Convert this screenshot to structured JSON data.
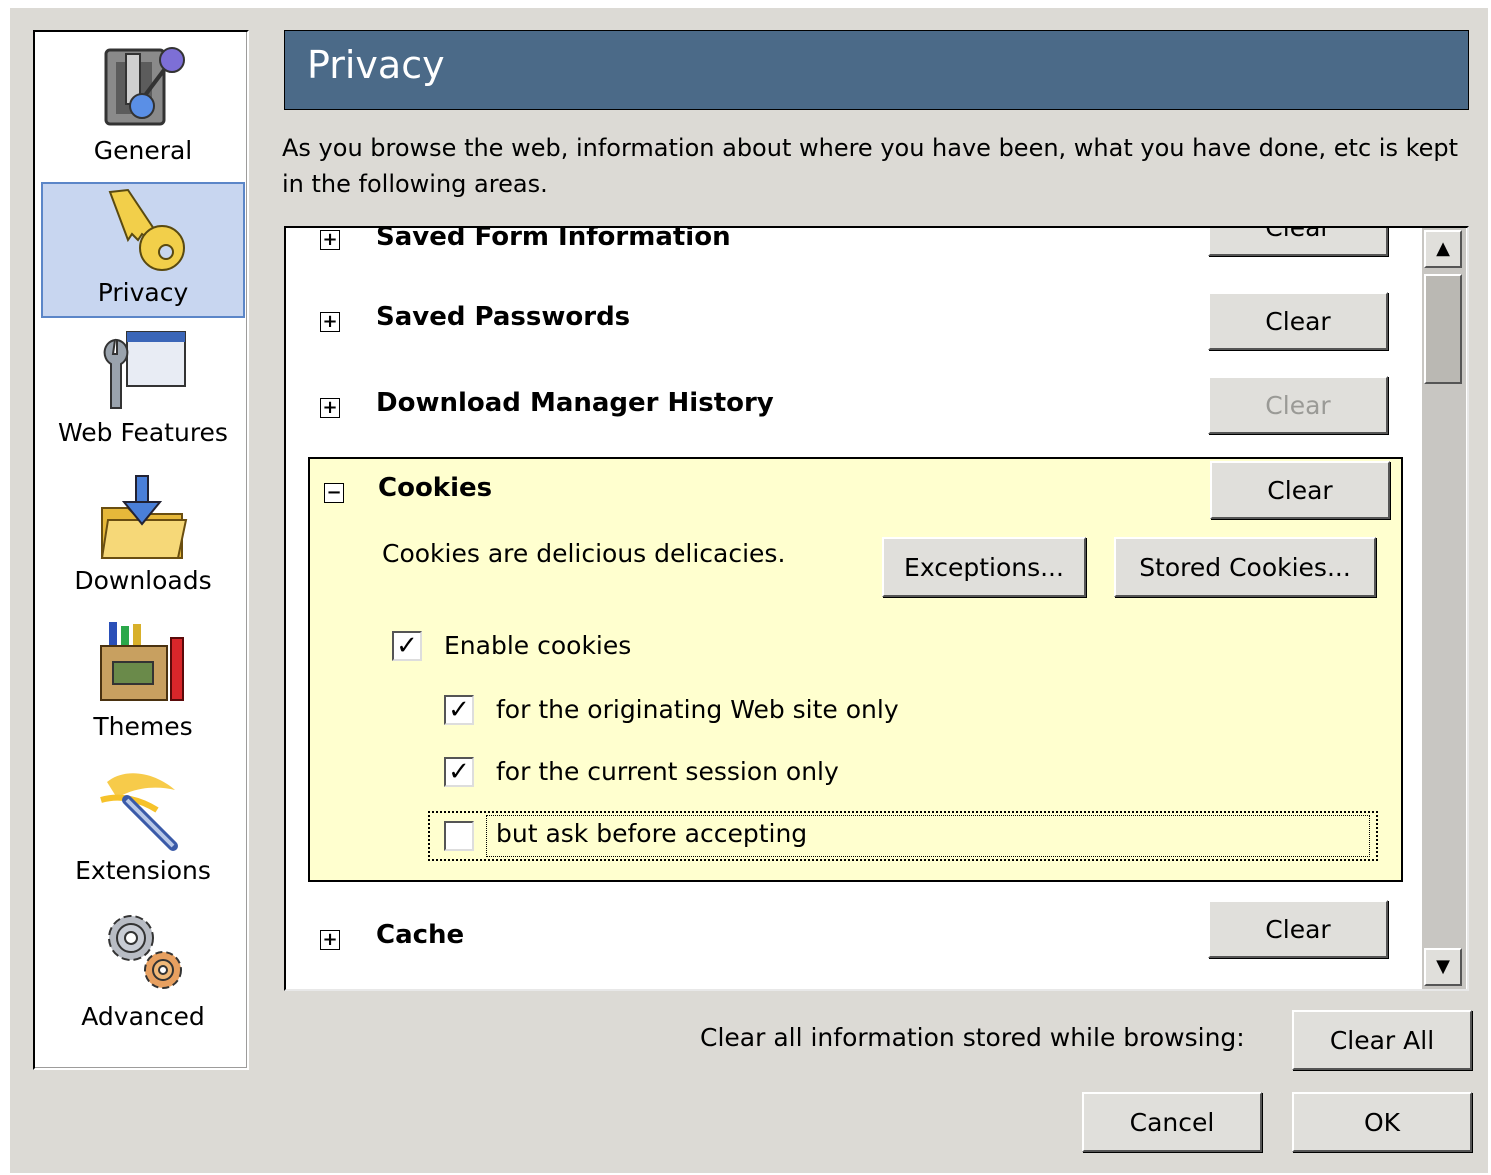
{
  "sidebar": {
    "items": [
      {
        "label": "General",
        "icon": "general-switch-icon"
      },
      {
        "label": "Privacy",
        "icon": "key-icon",
        "selected": true
      },
      {
        "label": "Web Features",
        "icon": "wrench-window-icon"
      },
      {
        "label": "Downloads",
        "icon": "download-folder-icon"
      },
      {
        "label": "Themes",
        "icon": "crayon-box-icon"
      },
      {
        "label": "Extensions",
        "icon": "magic-wand-icon"
      },
      {
        "label": "Advanced",
        "icon": "gears-icon"
      }
    ]
  },
  "header": {
    "title": "Privacy"
  },
  "description": "As you browse the web, information about where you have been, what you have done, etc is kept in the following areas.",
  "list": {
    "rows": [
      {
        "title": "Saved Form Information",
        "button": "Clear",
        "expander": "+"
      },
      {
        "title": "Saved Passwords",
        "button": "Clear",
        "expander": "+"
      },
      {
        "title": "Download Manager History",
        "button": "Clear",
        "expander": "+",
        "disabled": true
      },
      {
        "title": "Cookies",
        "button": "Clear",
        "expander": "−"
      },
      {
        "title": "Cache",
        "button": "Clear",
        "expander": "+"
      }
    ],
    "cookies": {
      "text": "Cookies are delicious delicacies.",
      "exceptions_label": "Exceptions...",
      "stored_label": "Stored Cookies...",
      "options": [
        {
          "label": "Enable cookies",
          "checked": true
        },
        {
          "label": "for the originating Web site only",
          "checked": true
        },
        {
          "label": "for the current session only",
          "checked": true
        },
        {
          "label": "but ask before accepting",
          "checked": false
        }
      ]
    }
  },
  "footer": {
    "clear_all_text": "Clear all information stored while browsing:",
    "clear_all_label": "Clear All",
    "cancel_label": "Cancel",
    "ok_label": "OK"
  },
  "check_glyph": "✓",
  "colors": {
    "header_bg": "#4b6a88",
    "panel_bg": "#ffffcf",
    "selected_bg": "#c8d6f0",
    "window_bg": "#dcdad5"
  }
}
